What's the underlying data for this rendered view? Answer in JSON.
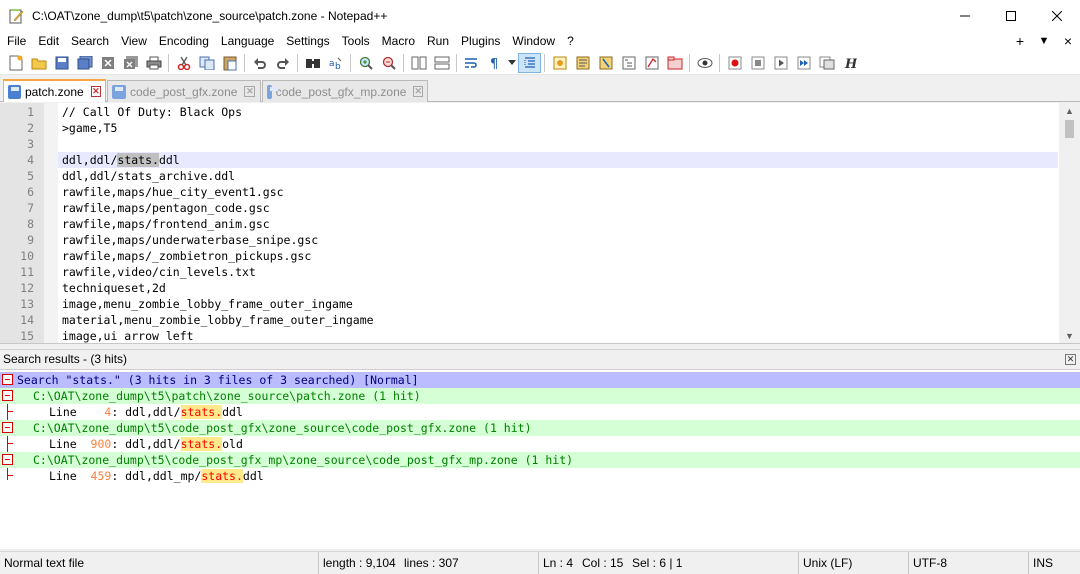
{
  "window": {
    "title": "C:\\OAT\\zone_dump\\t5\\patch\\zone_source\\patch.zone - Notepad++"
  },
  "menu": [
    "File",
    "Edit",
    "Search",
    "View",
    "Encoding",
    "Language",
    "Settings",
    "Tools",
    "Macro",
    "Run",
    "Plugins",
    "Window",
    "?"
  ],
  "menu_right": [
    "+",
    "▼",
    "×"
  ],
  "toolbar_icons": [
    "new-file-icon",
    "open-file-icon",
    "save-icon",
    "save-all-icon",
    "close-icon",
    "close-all-icon",
    "print-icon",
    "cut-icon",
    "copy-icon",
    "paste-icon",
    "undo-icon",
    "redo-icon",
    "find-icon",
    "replace-icon",
    "zoom-in-icon",
    "zoom-out-icon",
    "sync-vertical-icon",
    "sync-horizontal-icon",
    "word-wrap-icon",
    "show-all-chars-icon",
    "indent-guide-icon",
    "doc-map-icon",
    "function-list-icon",
    "folder-workspace-icon",
    "monitoring-icon",
    "record-macro-icon",
    "stop-macro-icon",
    "play-macro-icon",
    "run-macro-multiple-icon",
    "save-macro-icon",
    "spell-check-icon"
  ],
  "tabs": [
    {
      "label": "patch.zone",
      "active": true
    },
    {
      "label": "code_post_gfx.zone",
      "active": false
    },
    {
      "label": "code_post_gfx_mp.zone",
      "active": false
    }
  ],
  "editor": {
    "lines": [
      {
        "n": "1",
        "text": "// Call Of Duty: Black Ops"
      },
      {
        "n": "2",
        "text": ">game,T5"
      },
      {
        "n": "3",
        "text": ""
      },
      {
        "n": "4",
        "pre": "ddl,ddl/",
        "sel": "stats.",
        "post": "ddl"
      },
      {
        "n": "5",
        "text": "ddl,ddl/stats_archive.ddl"
      },
      {
        "n": "6",
        "text": "rawfile,maps/hue_city_event1.gsc"
      },
      {
        "n": "7",
        "text": "rawfile,maps/pentagon_code.gsc"
      },
      {
        "n": "8",
        "text": "rawfile,maps/frontend_anim.gsc"
      },
      {
        "n": "9",
        "text": "rawfile,maps/underwaterbase_snipe.gsc"
      },
      {
        "n": "10",
        "text": "rawfile,maps/_zombietron_pickups.gsc"
      },
      {
        "n": "11",
        "text": "rawfile,video/cin_levels.txt"
      },
      {
        "n": "12",
        "text": "techniqueset,2d"
      },
      {
        "n": "13",
        "text": "image,menu_zombie_lobby_frame_outer_ingame"
      },
      {
        "n": "14",
        "text": "material,menu_zombie_lobby_frame_outer_ingame"
      },
      {
        "n": "15",
        "text": "image,ui arrow left"
      }
    ]
  },
  "search_panel": {
    "title": "Search results - (3 hits)",
    "summary": "Search \"stats.\" (3 hits in 3 files of 3 searched) [Normal]",
    "results": [
      {
        "file": "C:\\OAT\\zone_dump\\t5\\patch\\zone_source\\patch.zone (1 hit)",
        "hit_prefix": "Line ",
        "line": "   4",
        "hit_pre": ": ddl,ddl/",
        "match": "stats.",
        "hit_post": "ddl"
      },
      {
        "file": "C:\\OAT\\zone_dump\\t5\\code_post_gfx\\zone_source\\code_post_gfx.zone (1 hit)",
        "hit_prefix": "Line ",
        "line": " 900",
        "hit_pre": ": ddl,ddl/",
        "match": "stats.",
        "hit_post": "old"
      },
      {
        "file": "C:\\OAT\\zone_dump\\t5\\code_post_gfx_mp\\zone_source\\code_post_gfx_mp.zone (1 hit)",
        "hit_prefix": "Line ",
        "line": " 459",
        "hit_pre": ": ddl,ddl_mp/",
        "match": "stats.",
        "hit_post": "ddl"
      }
    ]
  },
  "status": {
    "file_type": "Normal text file",
    "length": "length : 9,104",
    "lines": "lines : 307",
    "ln": "Ln : 4",
    "col": "Col : 15",
    "sel": "Sel : 6 | 1",
    "eol": "Unix (LF)",
    "encoding": "UTF-8",
    "mode": "INS"
  },
  "colors": {
    "search_header_bg": "#bbbbff",
    "file_header_bg": "#d5ffd5",
    "match_fg": "#ff0000",
    "match_bg": "#ffe98a",
    "current_line_bg": "#e8e8ff",
    "tab_accent": "#f7a545"
  }
}
